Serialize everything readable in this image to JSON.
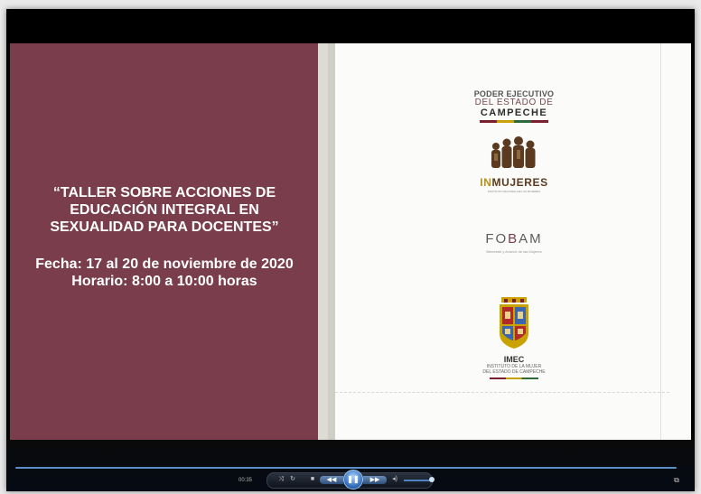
{
  "slide": {
    "title_lines": [
      "“TALLER SOBRE ACCIONES DE",
      "EDUCACIÓN INTEGRAL EN",
      "SEXUALIDAD PARA DOCENTES”"
    ],
    "date_line": "Fecha: 17 al 20 de noviembre de 2020",
    "time_line": "Horario: 8:00 a 10:00 horas",
    "panel_color": "#7a3d4c"
  },
  "logos": {
    "poder": {
      "line1": "PODER EJECUTIVO",
      "line2": "DEL ESTADO DE",
      "line3": "CAMPECHE"
    },
    "inmujeres": {
      "prefix": "IN",
      "name": "MUJERES",
      "subtitle": "INSTITUTO NACIONAL DE LAS MUJERES"
    },
    "fobam": {
      "part1": "FO",
      "part2": "B",
      "part3": "AM",
      "subtitle": "Bienestar y Avance de las Mujeres"
    },
    "imec": {
      "name": "IMEC",
      "sub1": "INSTITUTO DE LA MUJER",
      "sub2": "DEL ESTADO DE CAMPECHE"
    }
  },
  "player": {
    "time": "00:35",
    "accent": "#2a66b5",
    "progress_fraction": 0.02,
    "volume_fraction": 0.9,
    "controls": {
      "shuffle": "⤨",
      "repeat": "↻",
      "stop": "■",
      "prev": "◀◀",
      "pause": "❚❚",
      "next": "▶▶",
      "mute": "◂)",
      "fullview": "⧉"
    }
  }
}
